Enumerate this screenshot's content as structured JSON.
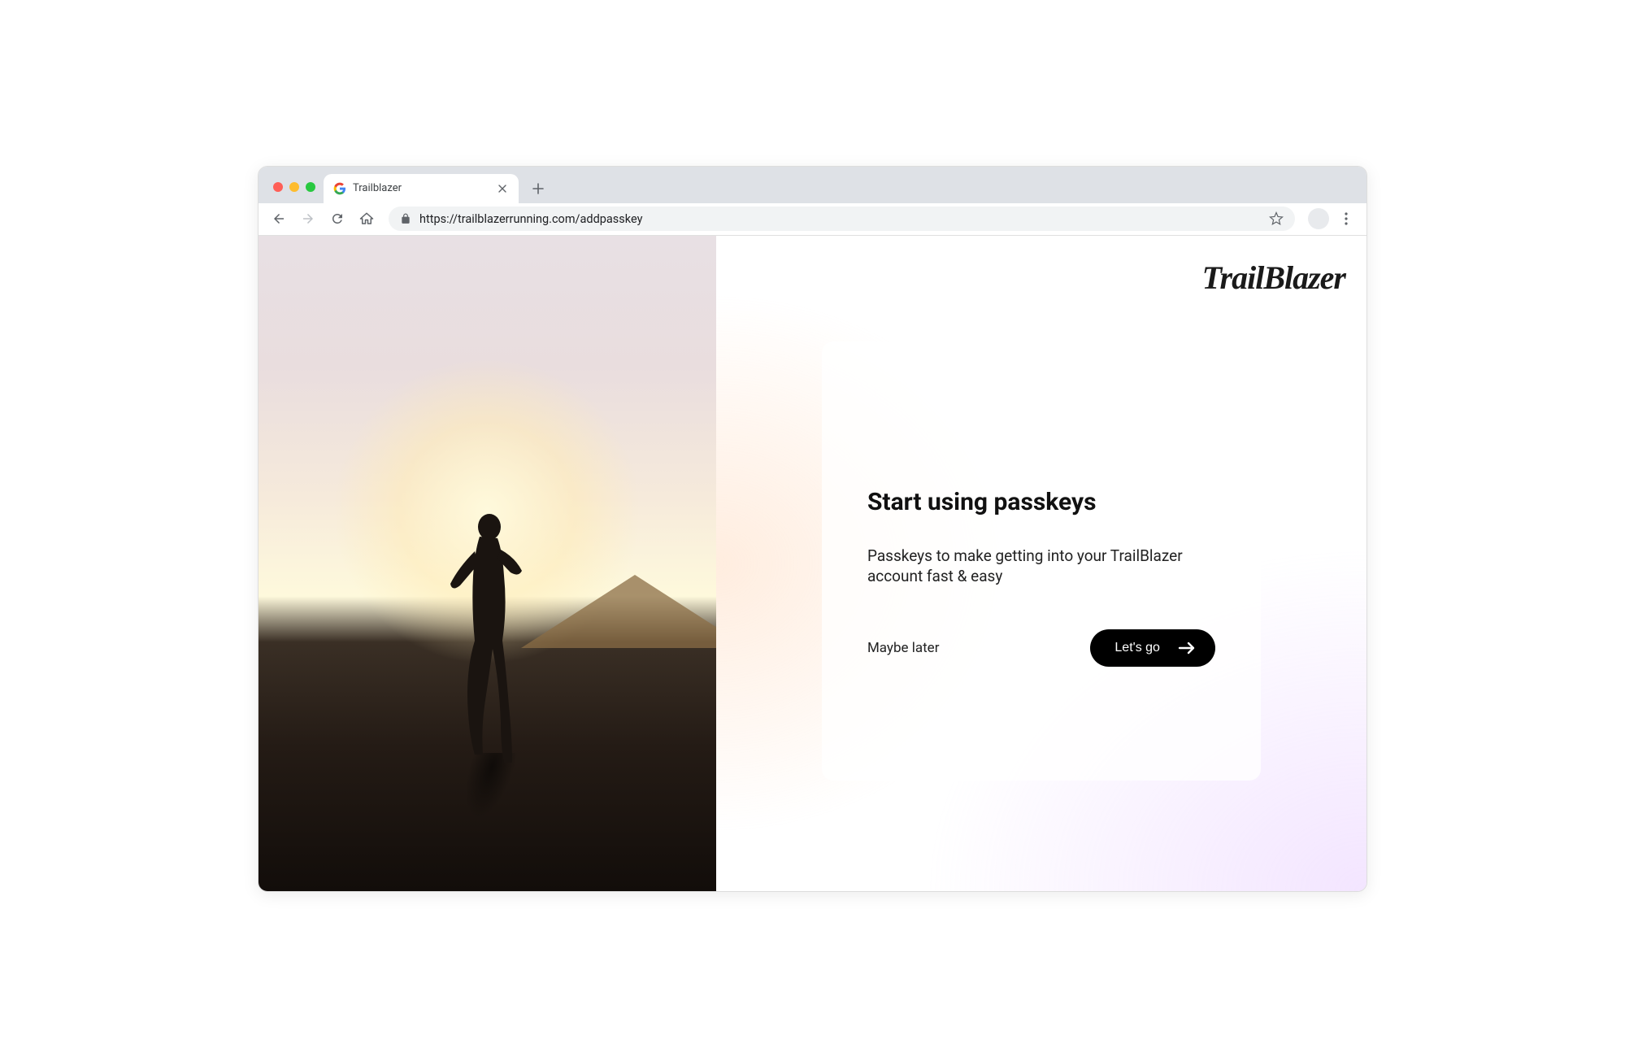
{
  "browser": {
    "tab_title": "Trailblazer",
    "url": "https://trailblazerrunning.com/addpasskey"
  },
  "brand": {
    "name": "TrailBlazer"
  },
  "card": {
    "heading": "Start using passkeys",
    "subtext": "Passkeys to make getting into your TrailBlazer account fast & easy",
    "secondary_action": "Maybe later",
    "primary_action": "Let's go"
  }
}
